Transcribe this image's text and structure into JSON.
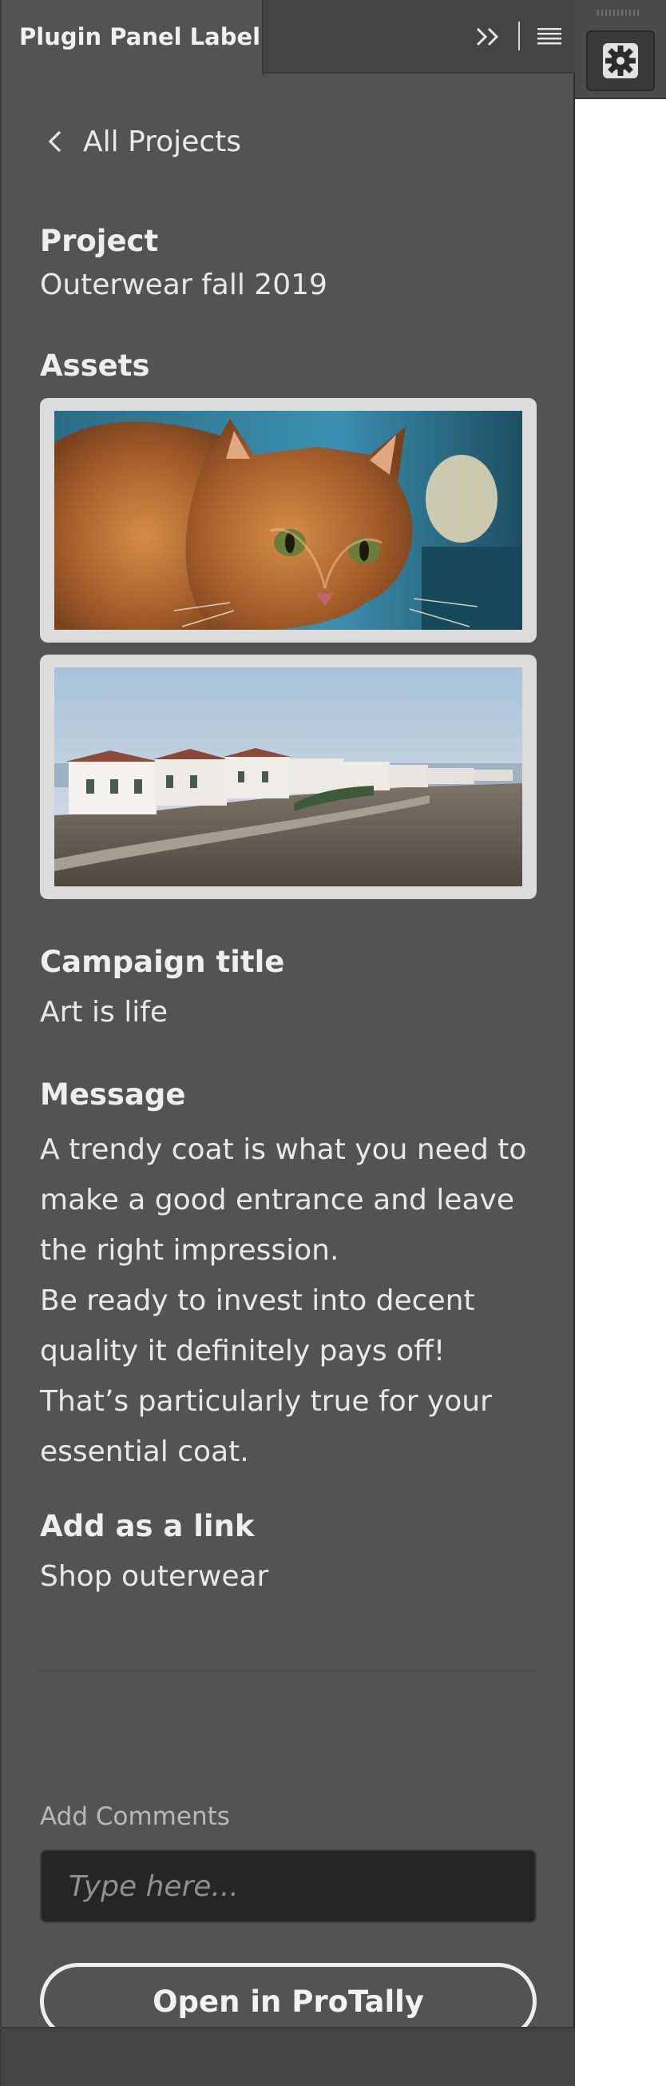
{
  "panel": {
    "tab_label": "Plugin Panel Label",
    "expand_icon": "double-chevron-right-icon",
    "menu_icon": "hamburger-menu-icon"
  },
  "nav": {
    "back_label": "All Projects",
    "back_icon": "chevron-left-icon"
  },
  "project": {
    "label": "Project",
    "value": "Outerwear fall 2019"
  },
  "assets": {
    "label": "Assets",
    "items": [
      {
        "name": "cat-photo"
      },
      {
        "name": "coastal-houses-photo"
      }
    ]
  },
  "campaign": {
    "label": "Campaign title",
    "value": "Art is life"
  },
  "message": {
    "label": "Message",
    "paragraphs": [
      "A trendy coat is what you need to make a good entrance and leave the right impression.",
      "Be ready to invest into decent quality it definitely pays off! That’s particularly true for your essential coat."
    ]
  },
  "link": {
    "label": "Add as a link",
    "value": "Shop outerwear"
  },
  "comments": {
    "label": "Add Comments",
    "placeholder": "Type here...",
    "value": ""
  },
  "actions": {
    "open_label": "Open in ProTally"
  },
  "dock": {
    "icon": "gear-icon"
  },
  "colors": {
    "panel_bg": "#535353",
    "tab_bar_bg": "#444444",
    "input_bg": "#252525",
    "text": "#ececec"
  }
}
